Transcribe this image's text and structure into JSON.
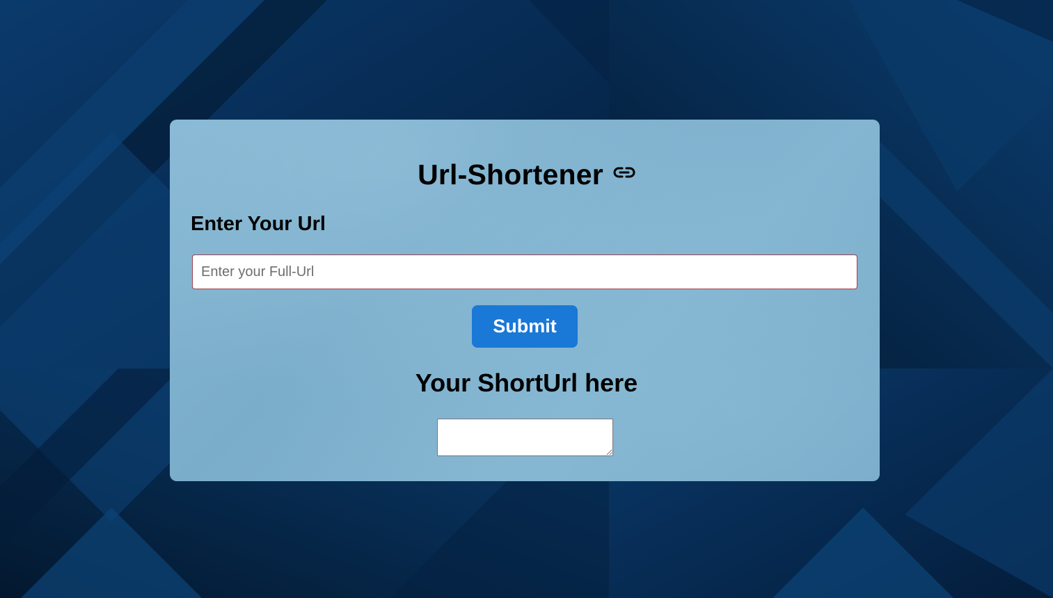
{
  "header": {
    "title": "Url-Shortener",
    "title_icon": "link-icon"
  },
  "form": {
    "url_label": "Enter Your Url",
    "url_input_value": "",
    "url_input_placeholder": "Enter your Full-Url",
    "submit_label": "Submit"
  },
  "result": {
    "heading": "Your ShortUrl here",
    "value": ""
  },
  "colors": {
    "background_dark": "#06264a",
    "card": "#7fb1ce",
    "button": "#1a78d6",
    "input_border": "#a0404a"
  }
}
